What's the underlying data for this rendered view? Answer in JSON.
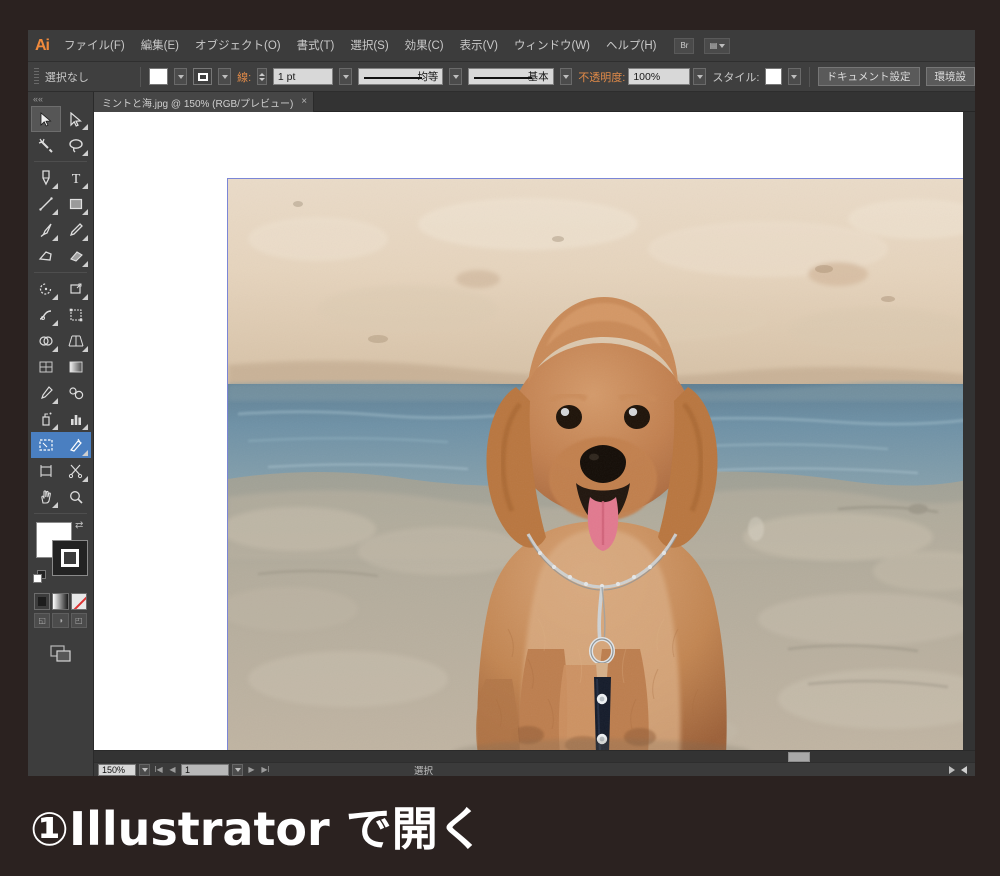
{
  "app": {
    "name": "Adobe Illustrator",
    "logo_text": "Ai"
  },
  "menubar": {
    "items": [
      {
        "label": "ファイル(F)"
      },
      {
        "label": "編集(E)"
      },
      {
        "label": "オブジェクト(O)"
      },
      {
        "label": "書式(T)"
      },
      {
        "label": "選択(S)"
      },
      {
        "label": "効果(C)"
      },
      {
        "label": "表示(V)"
      },
      {
        "label": "ウィンドウ(W)"
      },
      {
        "label": "ヘルプ(H)"
      }
    ],
    "bridge_button": "Br",
    "arrange_button": "▤"
  },
  "controlbar": {
    "selection_status": "選択なし",
    "fill_label": "fill-swatch",
    "stroke_label": "線:",
    "stroke_weight": "1 pt",
    "stroke_profile": "均等",
    "brush_definition": "基本",
    "opacity_label": "不透明度:",
    "opacity_value": "100%",
    "style_label": "スタイル:",
    "document_setup_button": "ドキュメント設定",
    "preferences_button": "環境設"
  },
  "document_tab": {
    "title": "ミントと海.jpg @ 150% (RGB/プレビュー)",
    "close_glyph": "×"
  },
  "tools": {
    "collapse_glyph": "««",
    "rows": [
      [
        {
          "name": "selection-tool",
          "glyph": "arrow-solid",
          "state": "active"
        },
        {
          "name": "direct-selection-tool",
          "glyph": "arrow-outline",
          "state": "normal"
        }
      ],
      [
        {
          "name": "magic-wand-tool",
          "glyph": "wand",
          "state": "normal"
        },
        {
          "name": "lasso-tool",
          "glyph": "lasso",
          "state": "normal"
        }
      ],
      [
        {
          "name": "pen-tool",
          "glyph": "pen",
          "state": "normal"
        },
        {
          "name": "type-tool",
          "glyph": "T",
          "state": "normal"
        }
      ],
      [
        {
          "name": "line-segment-tool",
          "glyph": "line",
          "state": "normal"
        },
        {
          "name": "rectangle-tool",
          "glyph": "rect",
          "state": "normal"
        }
      ],
      [
        {
          "name": "paintbrush-tool",
          "glyph": "brush",
          "state": "normal"
        },
        {
          "name": "pencil-tool",
          "glyph": "pencil",
          "state": "normal"
        }
      ],
      [
        {
          "name": "blob-brush-tool",
          "glyph": "blob",
          "state": "normal"
        },
        {
          "name": "eraser-tool",
          "glyph": "eraser",
          "state": "normal"
        }
      ],
      [
        {
          "name": "rotate-tool",
          "glyph": "rotate",
          "state": "normal"
        },
        {
          "name": "scale-tool",
          "glyph": "scale",
          "state": "normal"
        }
      ],
      [
        {
          "name": "width-tool",
          "glyph": "width",
          "state": "normal"
        },
        {
          "name": "free-transform-tool",
          "glyph": "freetransform",
          "state": "normal"
        }
      ],
      [
        {
          "name": "shape-builder-tool",
          "glyph": "shapebuilder",
          "state": "normal"
        },
        {
          "name": "perspective-grid-tool",
          "glyph": "perspective",
          "state": "normal"
        }
      ],
      [
        {
          "name": "mesh-tool",
          "glyph": "mesh",
          "state": "normal"
        },
        {
          "name": "gradient-tool",
          "glyph": "gradient",
          "state": "normal"
        }
      ],
      [
        {
          "name": "eyedropper-tool",
          "glyph": "eyedropper",
          "state": "normal"
        },
        {
          "name": "blend-tool",
          "glyph": "blend",
          "state": "normal"
        }
      ],
      [
        {
          "name": "symbol-sprayer-tool",
          "glyph": "sprayer",
          "state": "normal"
        },
        {
          "name": "column-graph-tool",
          "glyph": "graph",
          "state": "normal"
        }
      ],
      [
        {
          "name": "artboard-tool",
          "glyph": "artboard",
          "state": "selected"
        },
        {
          "name": "slice-tool",
          "glyph": "slice",
          "state": "selected"
        }
      ],
      [
        {
          "name": "crop-tool",
          "glyph": "crop",
          "state": "normal"
        },
        {
          "name": "scissors-tool",
          "glyph": "scissors",
          "state": "normal"
        }
      ],
      [
        {
          "name": "hand-tool",
          "glyph": "hand",
          "state": "normal"
        },
        {
          "name": "zoom-tool",
          "glyph": "magnifier",
          "state": "normal"
        }
      ]
    ],
    "fill_color": "#ffffff",
    "stroke_color": "#222222",
    "color_modes": [
      {
        "name": "color-swatch",
        "kind": "color"
      },
      {
        "name": "gradient-swatch",
        "kind": "gradient"
      },
      {
        "name": "none-swatch",
        "kind": "none"
      }
    ],
    "screen_modes": [
      {
        "name": "normal-screen-mode"
      },
      {
        "name": "full-screen-menu-mode"
      },
      {
        "name": "full-screen-mode"
      }
    ]
  },
  "statusbar": {
    "zoom_level": "150%",
    "page_number": "1",
    "status_text": "選択",
    "first_glyph": "I◀",
    "prev_glyph": "◀",
    "next_glyph": "▶",
    "last_glyph": "▶I"
  },
  "artwork": {
    "description": "ミントと海 — 砂浜に座る茶色のトイプードル、背景に青い海",
    "subject": "apricot toy poodle sitting on sand",
    "collar": "silver chain collar",
    "leash": "dark navy leash with two silver studs",
    "background": "pale sand bank, blue sea water, grey-tan wet sand"
  },
  "caption": {
    "text": "①Illustrator で開く"
  },
  "colors": {
    "window_chrome": "#3c3c3c",
    "panel_bg": "#3d3d3d",
    "canvas_bg": "#ffffff",
    "accent_orange": "#e08a48",
    "logo_orange": "#f08a3c",
    "selected_tool_blue": "#4a7fc1",
    "artboard_border": "#7b86d6",
    "page_bg": "#2b2220"
  }
}
